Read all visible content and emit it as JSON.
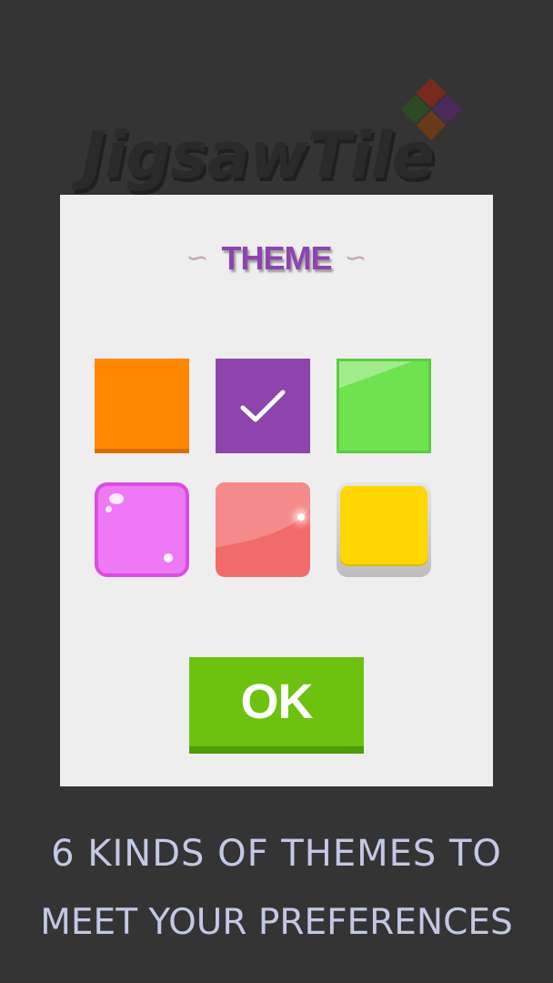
{
  "logo": {
    "text": "JigsawTile",
    "diamond_colors": [
      "#7a2a1c",
      "#4a2a5a",
      "#2d4a22",
      "#6a3a18"
    ]
  },
  "dialog": {
    "title": "THEME",
    "title_color": "#8e44ad",
    "squiggle_left": "∽",
    "squiggle_right": "∽",
    "themes": [
      {
        "name": "orange-flat",
        "color": "#ff8800",
        "selected": false
      },
      {
        "name": "purple-flat",
        "color": "#8e44ad",
        "selected": true,
        "check_icon": "✓"
      },
      {
        "name": "green-glass",
        "color": "#6ee24f",
        "selected": false
      },
      {
        "name": "pink-jelly",
        "color": "#ee78f5",
        "selected": false
      },
      {
        "name": "red-gloss",
        "color": "#f26b6b",
        "selected": false
      },
      {
        "name": "yellow-button",
        "color": "#ffd600",
        "selected": false
      }
    ],
    "ok_label": "OK",
    "ok_color": "#6cc20e"
  },
  "caption": {
    "line1": "6 KINDS OF THEMES TO",
    "line2": "MEET YOUR PREFERENCES"
  }
}
